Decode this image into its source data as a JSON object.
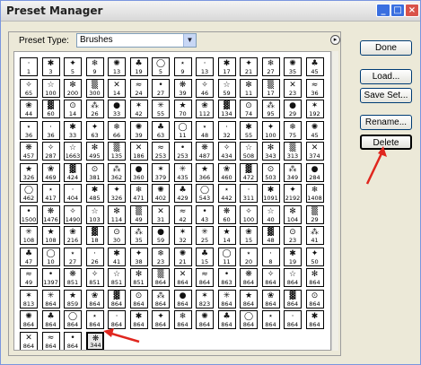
{
  "window": {
    "title": "Preset Manager"
  },
  "preset_type": {
    "label": "Preset Type:",
    "value": "Brushes"
  },
  "buttons": {
    "done": "Done",
    "load": "Load...",
    "save_set": "Save Set...",
    "rename": "Rename...",
    "delete": "Delete"
  },
  "titlebar": {
    "minimize": "_",
    "maximize": "□",
    "close": "×"
  },
  "brushes": [
    [
      "1",
      "3",
      "5",
      "9",
      "13",
      "19",
      "5",
      "9",
      "13",
      "17",
      "21",
      "27",
      "35",
      "45"
    ],
    [
      "65",
      "100",
      "200",
      "300",
      "14",
      "24",
      "27",
      "39",
      "46",
      "59",
      "11",
      "17",
      "23",
      "36"
    ],
    [
      "44",
      "60",
      "14",
      "26",
      "33",
      "42",
      "55",
      "70",
      "112",
      "134",
      "74",
      "95",
      "29",
      "192"
    ],
    [
      "36",
      "36",
      "33",
      "63",
      "66",
      "39",
      "63",
      "11",
      "48",
      "32",
      "55",
      "100",
      "75",
      "45"
    ],
    [
      "457",
      "287",
      "1663",
      "495",
      "135",
      "186",
      "253",
      "253",
      "487",
      "434",
      "508",
      "343",
      "313",
      "374"
    ],
    [
      "326",
      "469",
      "424",
      "381",
      "362",
      "360",
      "379",
      "435",
      "366",
      "460",
      "472",
      "503",
      "349",
      "284"
    ],
    [
      "462",
      "417",
      "404",
      "485",
      "326",
      "471",
      "402",
      "429",
      "543",
      "442",
      "311",
      "1091",
      "2192",
      "1408"
    ],
    [
      "1500",
      "1476",
      "1490",
      "103",
      "114",
      "49",
      "31",
      "42",
      "43",
      "60",
      "100",
      "40",
      "104",
      "29"
    ],
    [
      "108",
      "108",
      "216",
      "18",
      "30",
      "35",
      "59",
      "32",
      "25",
      "14",
      "15",
      "48",
      "23",
      "41"
    ],
    [
      "47",
      "10",
      "27",
      "26",
      "41",
      "38",
      "23",
      "21",
      "15",
      "11",
      "20",
      "8",
      "19",
      "50"
    ],
    [
      "49",
      "1397",
      "851",
      "851",
      "851",
      "851",
      "864",
      "864",
      "864",
      "863",
      "864",
      "864",
      "864",
      "864"
    ],
    [
      "813",
      "864",
      "859",
      "864",
      "864",
      "864",
      "864",
      "864",
      "823",
      "864",
      "864",
      "864",
      "864",
      "864"
    ],
    [
      "864",
      "864",
      "864",
      "864",
      "864",
      "864",
      "864",
      "864",
      "864",
      "864",
      "864",
      "864",
      "864",
      "864"
    ],
    [
      "864",
      "864",
      "864",
      "344"
    ]
  ],
  "selected_brush": {
    "row": 13,
    "col": 3
  }
}
